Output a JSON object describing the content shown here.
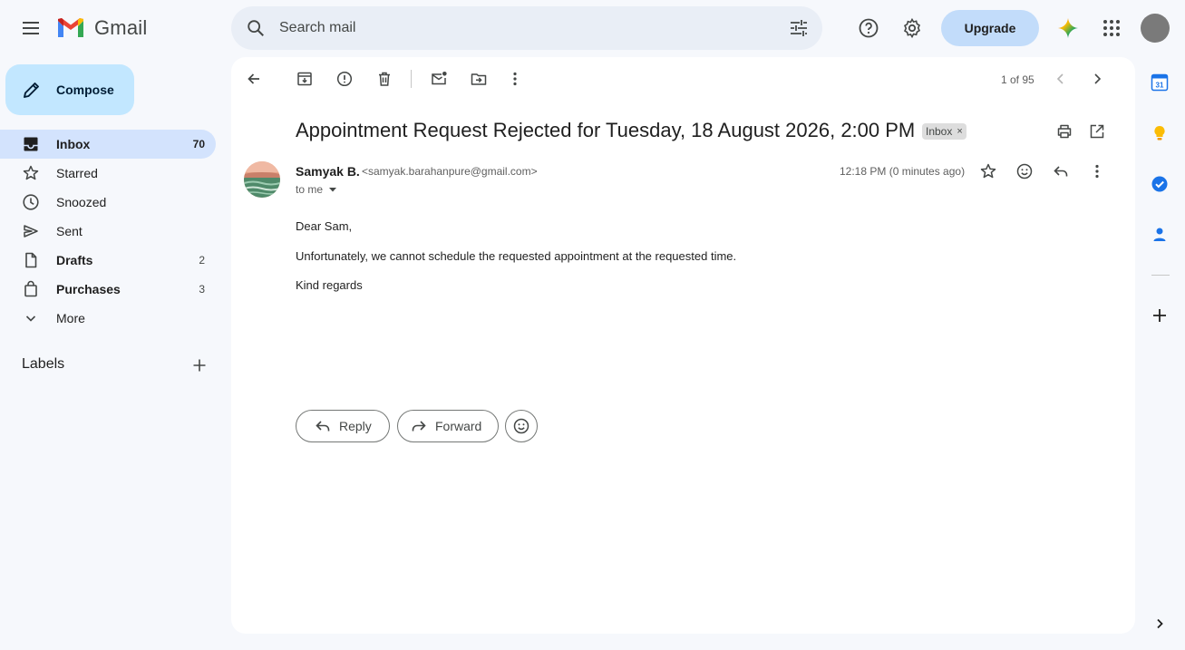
{
  "app": {
    "name": "Gmail"
  },
  "search": {
    "placeholder": "Search mail"
  },
  "header": {
    "upgrade_label": "Upgrade"
  },
  "compose": {
    "label": "Compose"
  },
  "sidebar": {
    "items": [
      {
        "label": "Inbox",
        "count": "70"
      },
      {
        "label": "Starred",
        "count": ""
      },
      {
        "label": "Snoozed",
        "count": ""
      },
      {
        "label": "Sent",
        "count": ""
      },
      {
        "label": "Drafts",
        "count": "2"
      },
      {
        "label": "Purchases",
        "count": "3"
      },
      {
        "label": "More",
        "count": ""
      }
    ],
    "labels_heading": "Labels"
  },
  "toolbar": {
    "pager": "1 of 95"
  },
  "email": {
    "subject": "Appointment Request Rejected for Tuesday, 18 August 2026, 2:00 PM",
    "label_chip": "Inbox",
    "chip_close": "×",
    "sender_name": "Samyak B.",
    "sender_email": "<samyak.barahanpure@gmail.com>",
    "to_line": "to me",
    "time": "12:18 PM (0 minutes ago)",
    "body": [
      "Dear Sam,",
      "Unfortunately, we cannot schedule the requested appointment at the requested time.",
      "Kind regards"
    ]
  },
  "actions": {
    "reply_label": "Reply",
    "forward_label": "Forward"
  },
  "rail": {
    "calendar_day": "31"
  },
  "colors": {
    "background": "#f6f8fc",
    "search_bg": "#e9eef6",
    "compose_bg": "#c2e7ff",
    "active_nav_bg": "#d3e3fd",
    "upgrade_bg": "#c2dcfa",
    "gmail_red": "#ea4335",
    "gmail_blue": "#4285f4",
    "gmail_green": "#34a853",
    "gmail_yellow": "#fbbc04"
  }
}
